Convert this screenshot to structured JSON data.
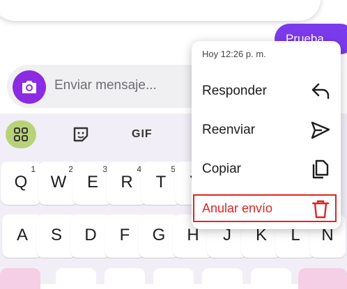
{
  "colors": {
    "accent": "#7c3aed",
    "camera": "#8b2be2",
    "danger": "#e02424",
    "keyboard_bg": "#f2eef7",
    "grid_button": "#b9d27a"
  },
  "reactions": [
    "emoji-smile",
    "emoji-laugh",
    "emoji-cry",
    "emoji-angry",
    "emoji-thumbs-up"
  ],
  "chat": {
    "message_text": "Prueba"
  },
  "composer": {
    "placeholder": "Enviar mensaje..."
  },
  "keyboard": {
    "toolbar": {
      "gif_label": "GIF"
    },
    "row1": [
      {
        "k": "Q",
        "n": "1"
      },
      {
        "k": "W",
        "n": "2"
      },
      {
        "k": "E",
        "n": "3"
      },
      {
        "k": "R",
        "n": "4"
      },
      {
        "k": "T",
        "n": "5"
      },
      {
        "k": "Y",
        "n": ""
      }
    ],
    "row2": [
      {
        "k": "A"
      },
      {
        "k": "S"
      },
      {
        "k": "D"
      },
      {
        "k": "F"
      },
      {
        "k": "G"
      },
      {
        "k": "H"
      },
      {
        "k": "J"
      },
      {
        "k": "K"
      },
      {
        "k": "L"
      },
      {
        "k": "N"
      }
    ]
  },
  "context_menu": {
    "timestamp": "Hoy 12:26 p. m.",
    "items": [
      {
        "label": "Responder",
        "icon": "reply-icon"
      },
      {
        "label": "Reenviar",
        "icon": "send-icon"
      },
      {
        "label": "Copiar",
        "icon": "copy-icon"
      },
      {
        "label": "Anular envío",
        "icon": "trash-icon"
      }
    ]
  }
}
